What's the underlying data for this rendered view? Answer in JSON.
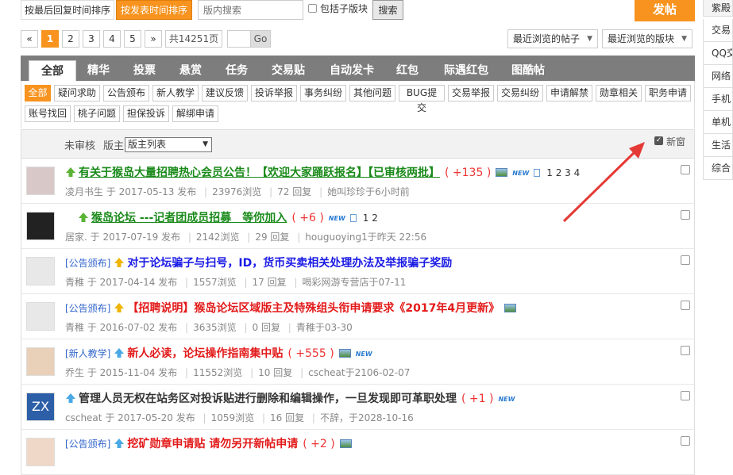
{
  "toolbar": {
    "sort_by_reply": "按最后回复时间排序",
    "sort_by_post": "按发表时间排序",
    "search_placeholder": "版内搜索",
    "include_sub": "包括子版块",
    "search_btn": "搜索",
    "post_btn": "发帖"
  },
  "pager": {
    "prev": "«",
    "pages": [
      "1",
      "2",
      "3",
      "4",
      "5"
    ],
    "next": "»",
    "total": "共14251页",
    "go": "Go"
  },
  "recent": {
    "threads": "最近浏览的帖子",
    "forums": "最近浏览的版块"
  },
  "tabs": [
    "全部",
    "精华",
    "投票",
    "悬赏",
    "任务",
    "交易贴",
    "自动发卡",
    "红包",
    "际遇红包",
    "图酷帖"
  ],
  "cats": [
    "全部",
    "疑问求助",
    "公告颁布",
    "新人教学",
    "建议反馈",
    "投诉举报",
    "事务纠纷",
    "其他问题",
    "BUG提交",
    "交易举报",
    "交易纠纷",
    "申请解禁",
    "勋章相关",
    "职务申请",
    "账号找回",
    "桃子问题",
    "担保投诉",
    "解绑申请"
  ],
  "filter": {
    "unreviewed": "未审核",
    "moderator_label": "版主",
    "moderator_select": "版主列表",
    "new_window": "新窗"
  },
  "threads": [
    {
      "tag": "",
      "title": "有关于猴岛大量招聘热心会员公告！【欢迎大家踊跃报名】【已审核两批】",
      "reply": "( +135 )",
      "img": true,
      "new": "NEW",
      "pages": "1 2 3 4",
      "author": "凌月书生",
      "date": "2017-05-13 发布",
      "views": "23976浏览",
      "replies": "72 回复",
      "last": "她叫珍珍于6小时前"
    },
    {
      "tag": "",
      "title": "猴岛论坛 ---记者团成员招募　等你加入",
      "reply": "( +6 )",
      "img": false,
      "new": "NEW",
      "pages": "1 2",
      "author": "居家.",
      "date": "2017-07-19 发布",
      "views": "2142浏览",
      "replies": "29 回复",
      "last": "houguoying1于昨天 22:56"
    },
    {
      "tag": "[公告颁布]",
      "title": "对于论坛骗子与扫号，ID，货币买卖相关处理办法及举报骗子奖励",
      "reply": "",
      "img": false,
      "new": "",
      "pages": "",
      "author": "青稚",
      "date": "2017-04-14 发布",
      "views": "1557浏览",
      "replies": "17 回复",
      "last": "喝彩网游专营店于07-11"
    },
    {
      "tag": "[公告颁布]",
      "title": "【招聘说明】猴岛论坛区域版主及特殊组头衔申请要求《2017年4月更新》",
      "reply": "",
      "img": true,
      "new": "",
      "pages": "",
      "author": "青稚",
      "date": "2016-07-02 发布",
      "views": "3635浏览",
      "replies": "0 回复",
      "last": "青稚于03-30"
    },
    {
      "tag": "[新人教学]",
      "title": "新人必读，论坛操作指南集中贴",
      "reply": "( +555 )",
      "img": true,
      "new": "NEW",
      "pages": "",
      "author": "乔生",
      "date": "2015-11-04 发布",
      "views": "11552浏览",
      "replies": "10 回复",
      "last": "cscheat于2106-02-07"
    },
    {
      "tag": "",
      "title": "管理人员无权在站务区对投诉贴进行删除和编辑操作，一旦发现即可革职处理",
      "reply": "( +1 )",
      "img": false,
      "new": "NEW",
      "pages": "",
      "author": "cscheat",
      "date": "2017-05-20 发布",
      "views": "1059浏览",
      "replies": "16 回复",
      "last": "不辞，于2028-10-16"
    },
    {
      "tag": "[公告颁布]",
      "title": "挖矿勋章申请贴 请勿另开新帖申请",
      "reply": "( +2 )",
      "img": true,
      "new": "",
      "pages": "",
      "author": "",
      "date": "",
      "views": "",
      "replies": "",
      "last": ""
    }
  ],
  "side": [
    "紫殿",
    "交易",
    "QQ交",
    "网络",
    "手机",
    "单机",
    "生活",
    "综合"
  ],
  "colors": {
    "accent": "#f7931e",
    "title_green": "#1a8a1a",
    "title_blue": "#1a1ae6",
    "title_red": "#e31a1a",
    "arrow": "#e53935"
  }
}
